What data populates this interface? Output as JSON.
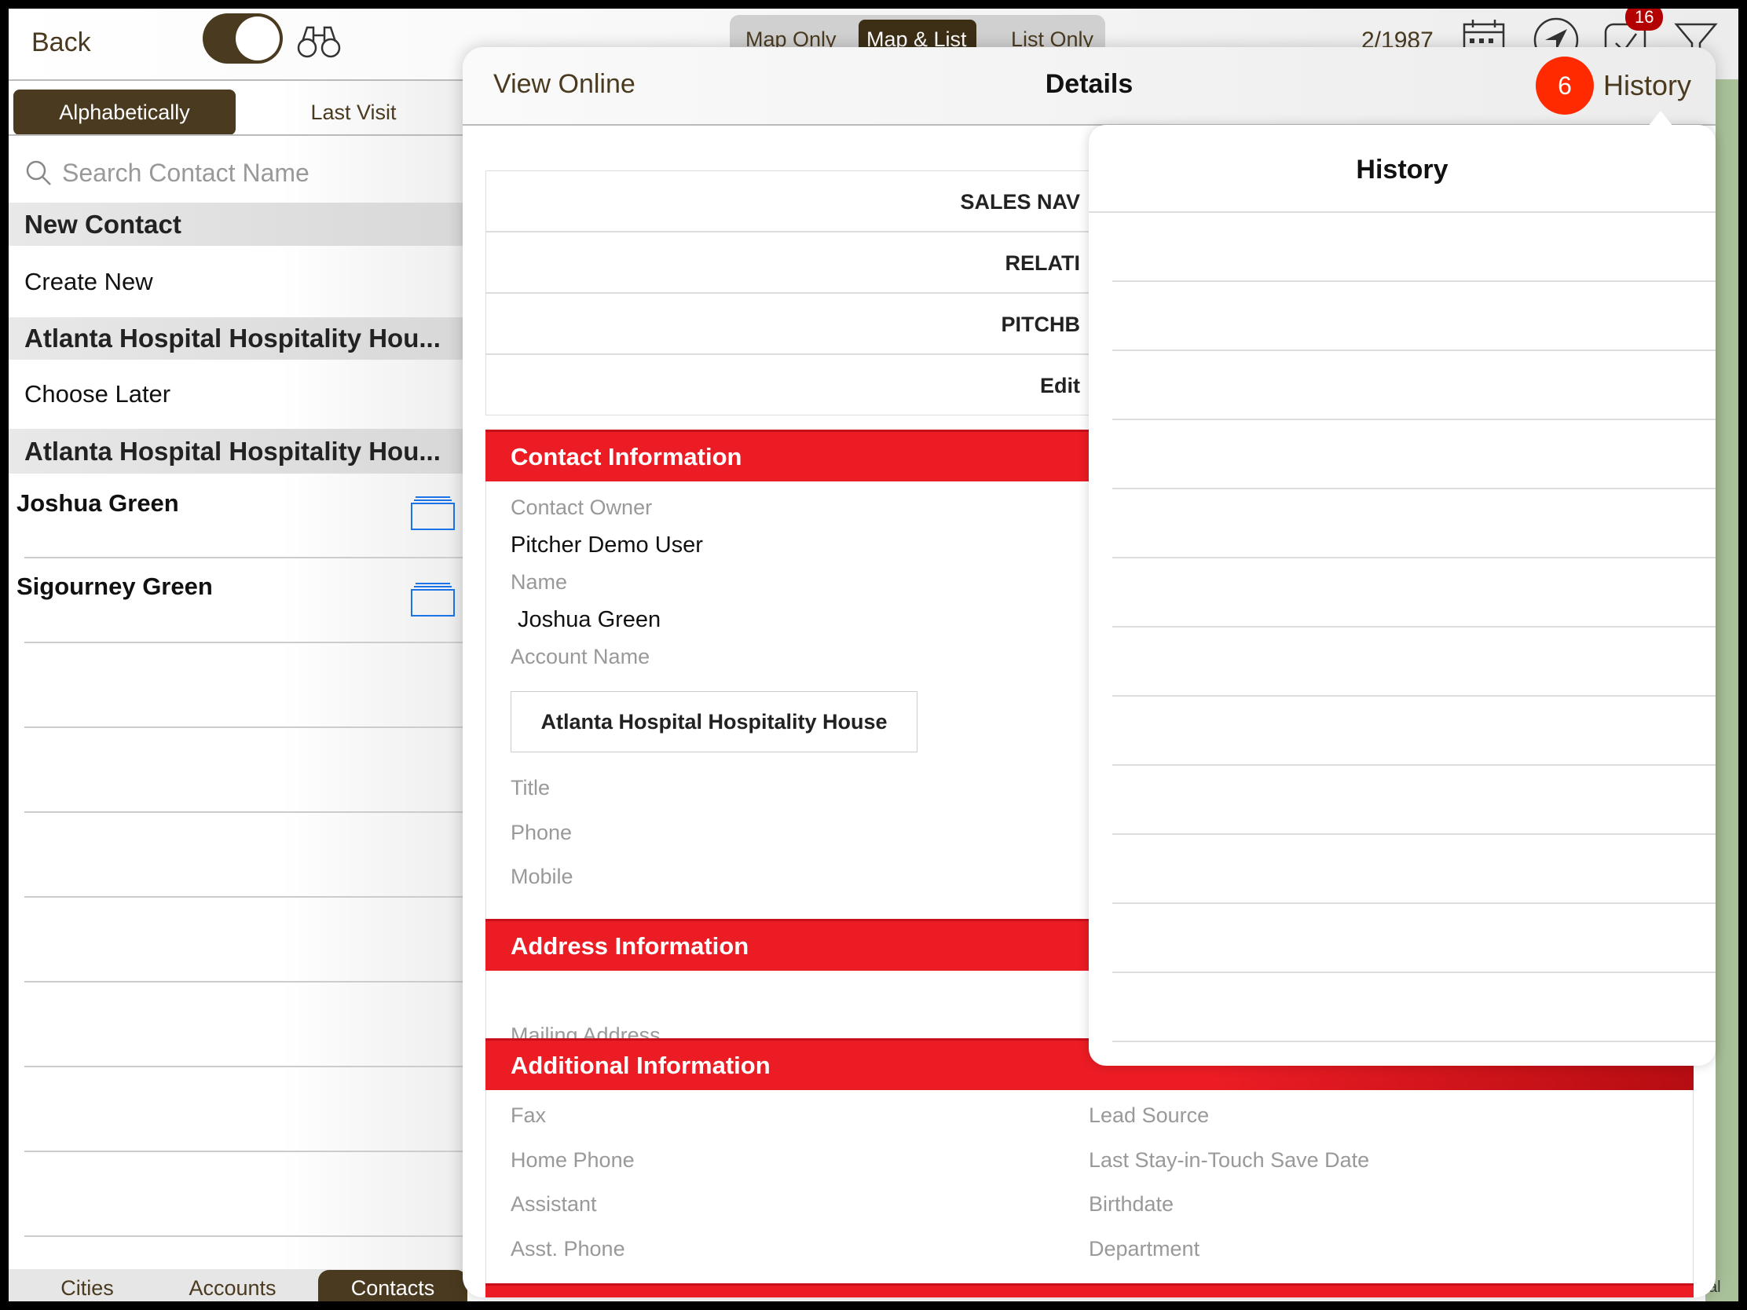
{
  "topbar": {
    "back": "Back",
    "toggle_on": true,
    "view_modes": [
      "Map Only",
      "Map & List",
      "List Only"
    ],
    "selected_view": "Map & List",
    "counter": "2/1987",
    "tasks_badge": "16",
    "brand_color": "#4a3a1f"
  },
  "left": {
    "sort_tabs": [
      "Alphabetically",
      "Last Visit"
    ],
    "selected_sort": "Alphabetically",
    "search_placeholder": "Search Contact Name",
    "sections": [
      {
        "header": "New Contact",
        "row": "Create New"
      },
      {
        "header": "Atlanta Hospital Hospitality Hou...",
        "row": "Choose Later"
      },
      {
        "header": "Atlanta Hospital Hospitality Hou..."
      }
    ],
    "contacts": [
      "Joshua Green",
      "Sigourney Green"
    ],
    "bottom_tabs": [
      "Cities",
      "Accounts",
      "Contacts"
    ],
    "selected_tab": "Contacts"
  },
  "panel": {
    "view_online": "View Online",
    "title": "Details",
    "history_badge": "6",
    "history": "History",
    "buttons": [
      "SALES NAV",
      "RELATI",
      "PITCHB",
      "Edit"
    ],
    "contact_info": {
      "header": "Contact Information",
      "owner_label": "Contact Owner",
      "owner": "Pitcher Demo User",
      "name_label": "Name",
      "name": "Joshua Green",
      "account_label": "Account Name",
      "account": "Atlanta Hospital Hospitality House",
      "title_label": "Title",
      "phone_label": "Phone",
      "mobile_label": "Mobile"
    },
    "address_info": {
      "header": "Address Information",
      "mailing_label": "Mailing Address"
    },
    "additional_info": {
      "header": "Additional Information",
      "left": [
        "Fax",
        "Home Phone",
        "Assistant",
        "Asst. Phone"
      ],
      "right": [
        "Lead Source",
        "Last Stay-in-Touch Save Date",
        "Birthdate",
        "Department"
      ]
    },
    "accent_color": "#ec1c24"
  },
  "history_popover": {
    "title": "History"
  },
  "map_label": "al"
}
